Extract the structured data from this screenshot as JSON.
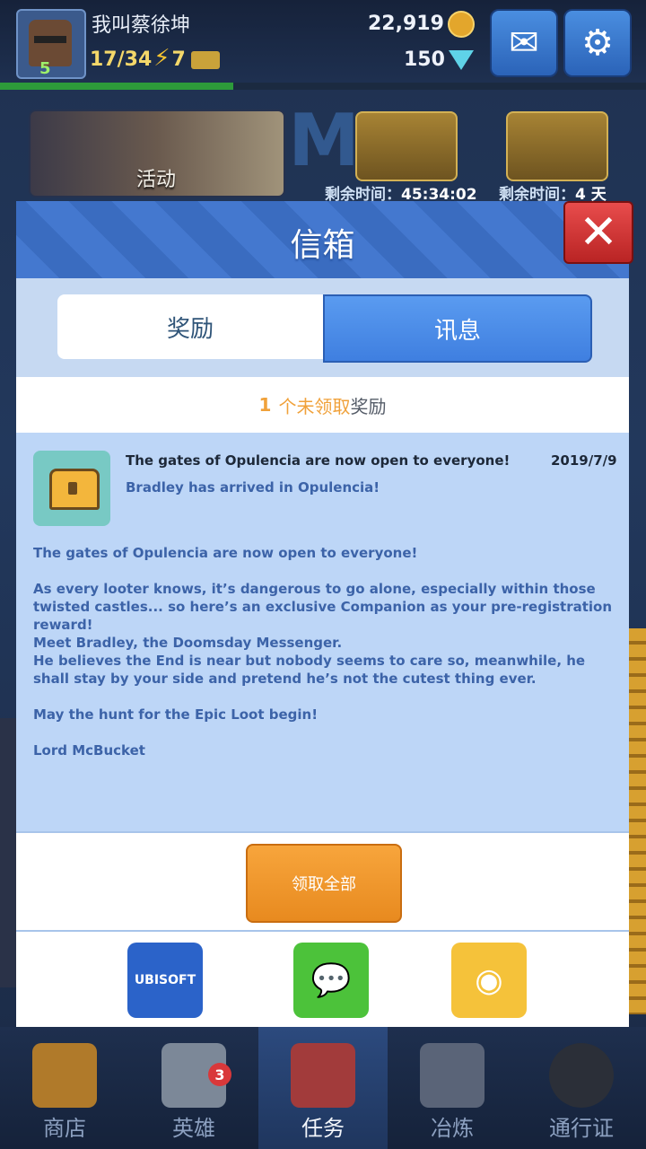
{
  "player": {
    "name": "我叫蔡徐坤",
    "level": "5",
    "crowns": "17/34",
    "energy": "7"
  },
  "currency": {
    "gold": "22,919",
    "gems": "150"
  },
  "banner": {
    "label": "活动"
  },
  "offers": [
    {
      "timer_label": "剩余时间：",
      "timer_value": "45:34:02"
    },
    {
      "timer_label": "剩余时间：",
      "timer_value": "4 天"
    }
  ],
  "mailbox": {
    "title": "信箱",
    "close_label": "✕",
    "tabs": [
      {
        "label": "奖励"
      },
      {
        "label": "讯息"
      }
    ],
    "unclaimed": {
      "count": "1",
      "text": "个未领取",
      "suffix": "奖励"
    },
    "message": {
      "title": "The gates of Opulencia are now open to everyone!",
      "date": "2019/7/9",
      "subtitle": "Bradley has arrived in Opulencia!",
      "body": [
        "The gates of Opulencia are now open to everyone!",
        "As every looter knows, it’s dangerous to go alone, especially within those twisted castles... so here’s an exclusive Companion as your pre-registration reward!\nMeet Bradley, the Doomsday Messenger.\nHe believes the End is near but nobody seems to care so, meanwhile, he shall stay by your side and pretend he’s not the cutest thing ever.",
        "May the hunt for the Epic Loot begin!",
        "Lord McBucket"
      ]
    },
    "claim_all_label": "领取全部",
    "social": [
      {
        "name": "ubisoft",
        "label": "UBISOFT"
      },
      {
        "name": "wechat",
        "label": ""
      },
      {
        "name": "weibo",
        "label": ""
      }
    ]
  },
  "nav": [
    {
      "label": "商店"
    },
    {
      "label": "英雄",
      "badge": "3"
    },
    {
      "label": "任务"
    },
    {
      "label": "冶炼"
    },
    {
      "label": "通行证"
    }
  ],
  "colors": {
    "accent": "#3f7fe0",
    "claim": "#f0a13a",
    "close": "#d9383a"
  }
}
